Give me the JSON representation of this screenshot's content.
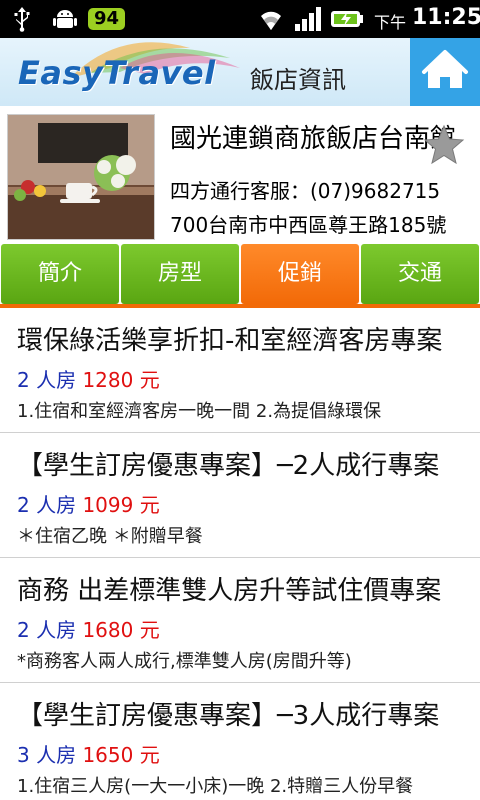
{
  "status_bar": {
    "battery_badge": "94",
    "ampm": "下午",
    "time": "11:25",
    "icons": [
      "usb-icon",
      "android-debug-icon",
      "wifi-icon",
      "signal-icon",
      "battery-charging-icon"
    ]
  },
  "header": {
    "logo": "EasyTravel",
    "title": "飯店資訊",
    "home_icon": "home-icon",
    "accent_color": "#34a3e6"
  },
  "hotel": {
    "name": "國光連鎖商旅飯店台南館",
    "phone": "四方通行客服：(07)9682715",
    "address": "700台南市中西區尊王路185號"
  },
  "tabs": [
    {
      "label": "簡介",
      "active": false
    },
    {
      "label": "房型",
      "active": false
    },
    {
      "label": "促銷",
      "active": true
    },
    {
      "label": "交通",
      "active": false
    }
  ],
  "promotions": [
    {
      "title": "環保綠活樂享折扣-和室經濟客房專案",
      "room_type": "2 人房",
      "price": "1280 元",
      "description": "1.住宿和室經濟客房一晚一間 2.為提倡綠環保"
    },
    {
      "title": "【學生訂房優惠專案】─2人成行專案",
      "room_type": "2 人房",
      "price": "1099 元",
      "description": "＊住宿乙晚  ＊附贈早餐"
    },
    {
      "title": "商務 出差標準雙人房升等試住價專案",
      "room_type": "2 人房",
      "price": "1680 元",
      "description": "*商務客人兩人成行,標準雙人房(房間升等)"
    },
    {
      "title": "【學生訂房優惠專案】─3人成行專案",
      "room_type": "3 人房",
      "price": "1650 元",
      "description": "1.住宿三人房(一大一小床)一晚 2.特贈三人份早餐"
    }
  ]
}
